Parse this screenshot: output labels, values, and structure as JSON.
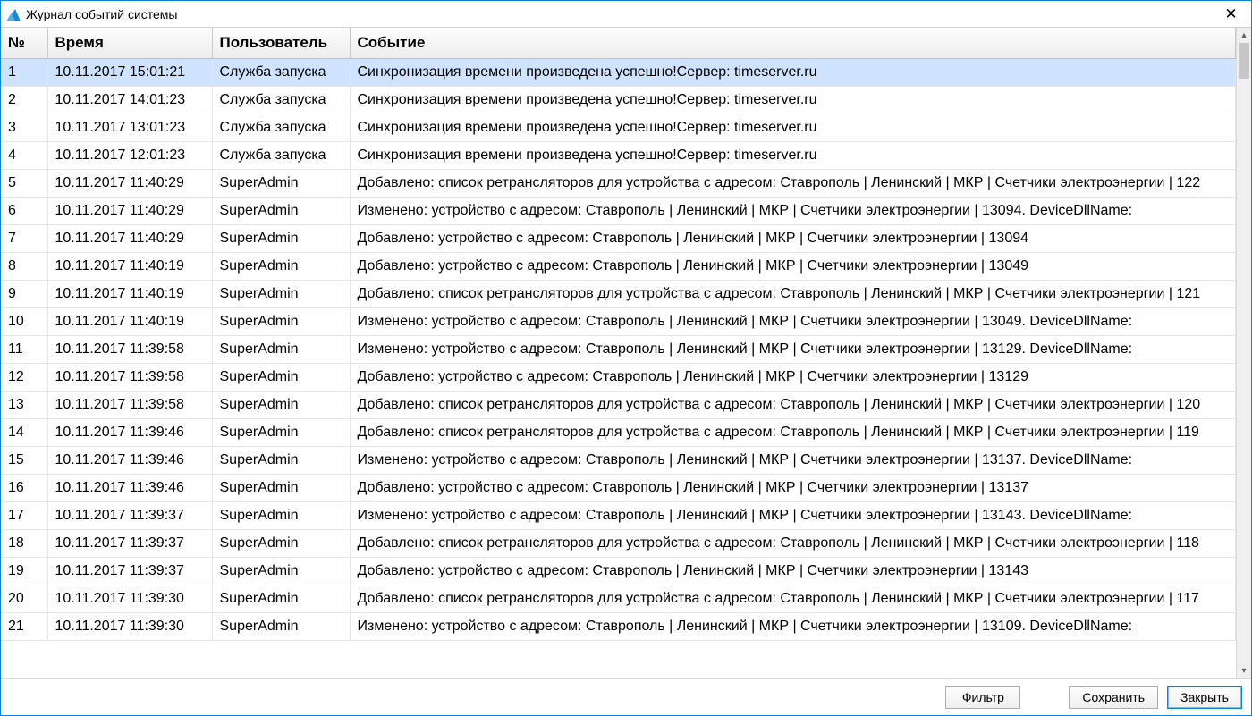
{
  "window": {
    "title": "Журнал событий системы",
    "close_glyph": "✕"
  },
  "columns": {
    "num": "№",
    "time": "Время",
    "user": "Пользователь",
    "event": "Событие"
  },
  "rows": [
    {
      "n": "1",
      "time": "10.11.2017 15:01:21",
      "user": "Служба запуска",
      "event": "Синхронизация времени произведена успешно!Сервер: timeserver.ru",
      "selected": true
    },
    {
      "n": "2",
      "time": "10.11.2017 14:01:23",
      "user": "Служба запуска",
      "event": "Синхронизация времени произведена успешно!Сервер: timeserver.ru"
    },
    {
      "n": "3",
      "time": "10.11.2017 13:01:23",
      "user": "Служба запуска",
      "event": "Синхронизация времени произведена успешно!Сервер: timeserver.ru"
    },
    {
      "n": "4",
      "time": "10.11.2017 12:01:23",
      "user": "Служба запуска",
      "event": "Синхронизация времени произведена успешно!Сервер: timeserver.ru"
    },
    {
      "n": "5",
      "time": "10.11.2017 11:40:29",
      "user": "SuperAdmin",
      "event": "Добавлено: список ретрансляторов для устройства с адресом: Ставрополь | Ленинский | МКР | Счетчики электроэнергии | 122"
    },
    {
      "n": "6",
      "time": "10.11.2017 11:40:29",
      "user": "SuperAdmin",
      "event": "Изменено: устройство с адресом: Ставрополь | Ленинский | МКР | Счетчики электроэнергии | 13094. DeviceDllName:"
    },
    {
      "n": "7",
      "time": "10.11.2017 11:40:29",
      "user": "SuperAdmin",
      "event": "Добавлено: устройство с адресом: Ставрополь | Ленинский | МКР | Счетчики электроэнергии | 13094"
    },
    {
      "n": "8",
      "time": "10.11.2017 11:40:19",
      "user": "SuperAdmin",
      "event": "Добавлено: устройство с адресом: Ставрополь | Ленинский | МКР | Счетчики электроэнергии | 13049"
    },
    {
      "n": "9",
      "time": "10.11.2017 11:40:19",
      "user": "SuperAdmin",
      "event": "Добавлено: список ретрансляторов для устройства с адресом: Ставрополь | Ленинский | МКР | Счетчики электроэнергии | 121"
    },
    {
      "n": "10",
      "time": "10.11.2017 11:40:19",
      "user": "SuperAdmin",
      "event": "Изменено: устройство с адресом: Ставрополь | Ленинский | МКР | Счетчики электроэнергии | 13049. DeviceDllName:"
    },
    {
      "n": "11",
      "time": "10.11.2017 11:39:58",
      "user": "SuperAdmin",
      "event": "Изменено: устройство с адресом: Ставрополь | Ленинский | МКР | Счетчики электроэнергии | 13129. DeviceDllName:"
    },
    {
      "n": "12",
      "time": "10.11.2017 11:39:58",
      "user": "SuperAdmin",
      "event": "Добавлено: устройство с адресом: Ставрополь | Ленинский | МКР | Счетчики электроэнергии | 13129"
    },
    {
      "n": "13",
      "time": "10.11.2017 11:39:58",
      "user": "SuperAdmin",
      "event": "Добавлено: список ретрансляторов для устройства с адресом: Ставрополь | Ленинский | МКР | Счетчики электроэнергии | 120"
    },
    {
      "n": "14",
      "time": "10.11.2017 11:39:46",
      "user": "SuperAdmin",
      "event": "Добавлено: список ретрансляторов для устройства с адресом: Ставрополь | Ленинский | МКР | Счетчики электроэнергии | 119"
    },
    {
      "n": "15",
      "time": "10.11.2017 11:39:46",
      "user": "SuperAdmin",
      "event": "Изменено: устройство с адресом: Ставрополь | Ленинский | МКР | Счетчики электроэнергии | 13137. DeviceDllName:"
    },
    {
      "n": "16",
      "time": "10.11.2017 11:39:46",
      "user": "SuperAdmin",
      "event": "Добавлено: устройство с адресом: Ставрополь | Ленинский | МКР | Счетчики электроэнергии | 13137"
    },
    {
      "n": "17",
      "time": "10.11.2017 11:39:37",
      "user": "SuperAdmin",
      "event": "Изменено: устройство с адресом: Ставрополь | Ленинский | МКР | Счетчики электроэнергии | 13143. DeviceDllName:"
    },
    {
      "n": "18",
      "time": "10.11.2017 11:39:37",
      "user": "SuperAdmin",
      "event": "Добавлено: список ретрансляторов для устройства с адресом: Ставрополь | Ленинский | МКР | Счетчики электроэнергии | 118"
    },
    {
      "n": "19",
      "time": "10.11.2017 11:39:37",
      "user": "SuperAdmin",
      "event": "Добавлено: устройство с адресом: Ставрополь | Ленинский | МКР | Счетчики электроэнергии | 13143"
    },
    {
      "n": "20",
      "time": "10.11.2017 11:39:30",
      "user": "SuperAdmin",
      "event": "Добавлено: список ретрансляторов для устройства с адресом: Ставрополь | Ленинский | МКР | Счетчики электроэнергии | 117"
    },
    {
      "n": "21",
      "time": "10.11.2017 11:39:30",
      "user": "SuperAdmin",
      "event": "Изменено: устройство с адресом: Ставрополь | Ленинский | МКР | Счетчики электроэнергии | 13109. DeviceDllName:"
    }
  ],
  "buttons": {
    "filter": "Фильтр",
    "save": "Сохранить",
    "close": "Закрыть"
  }
}
